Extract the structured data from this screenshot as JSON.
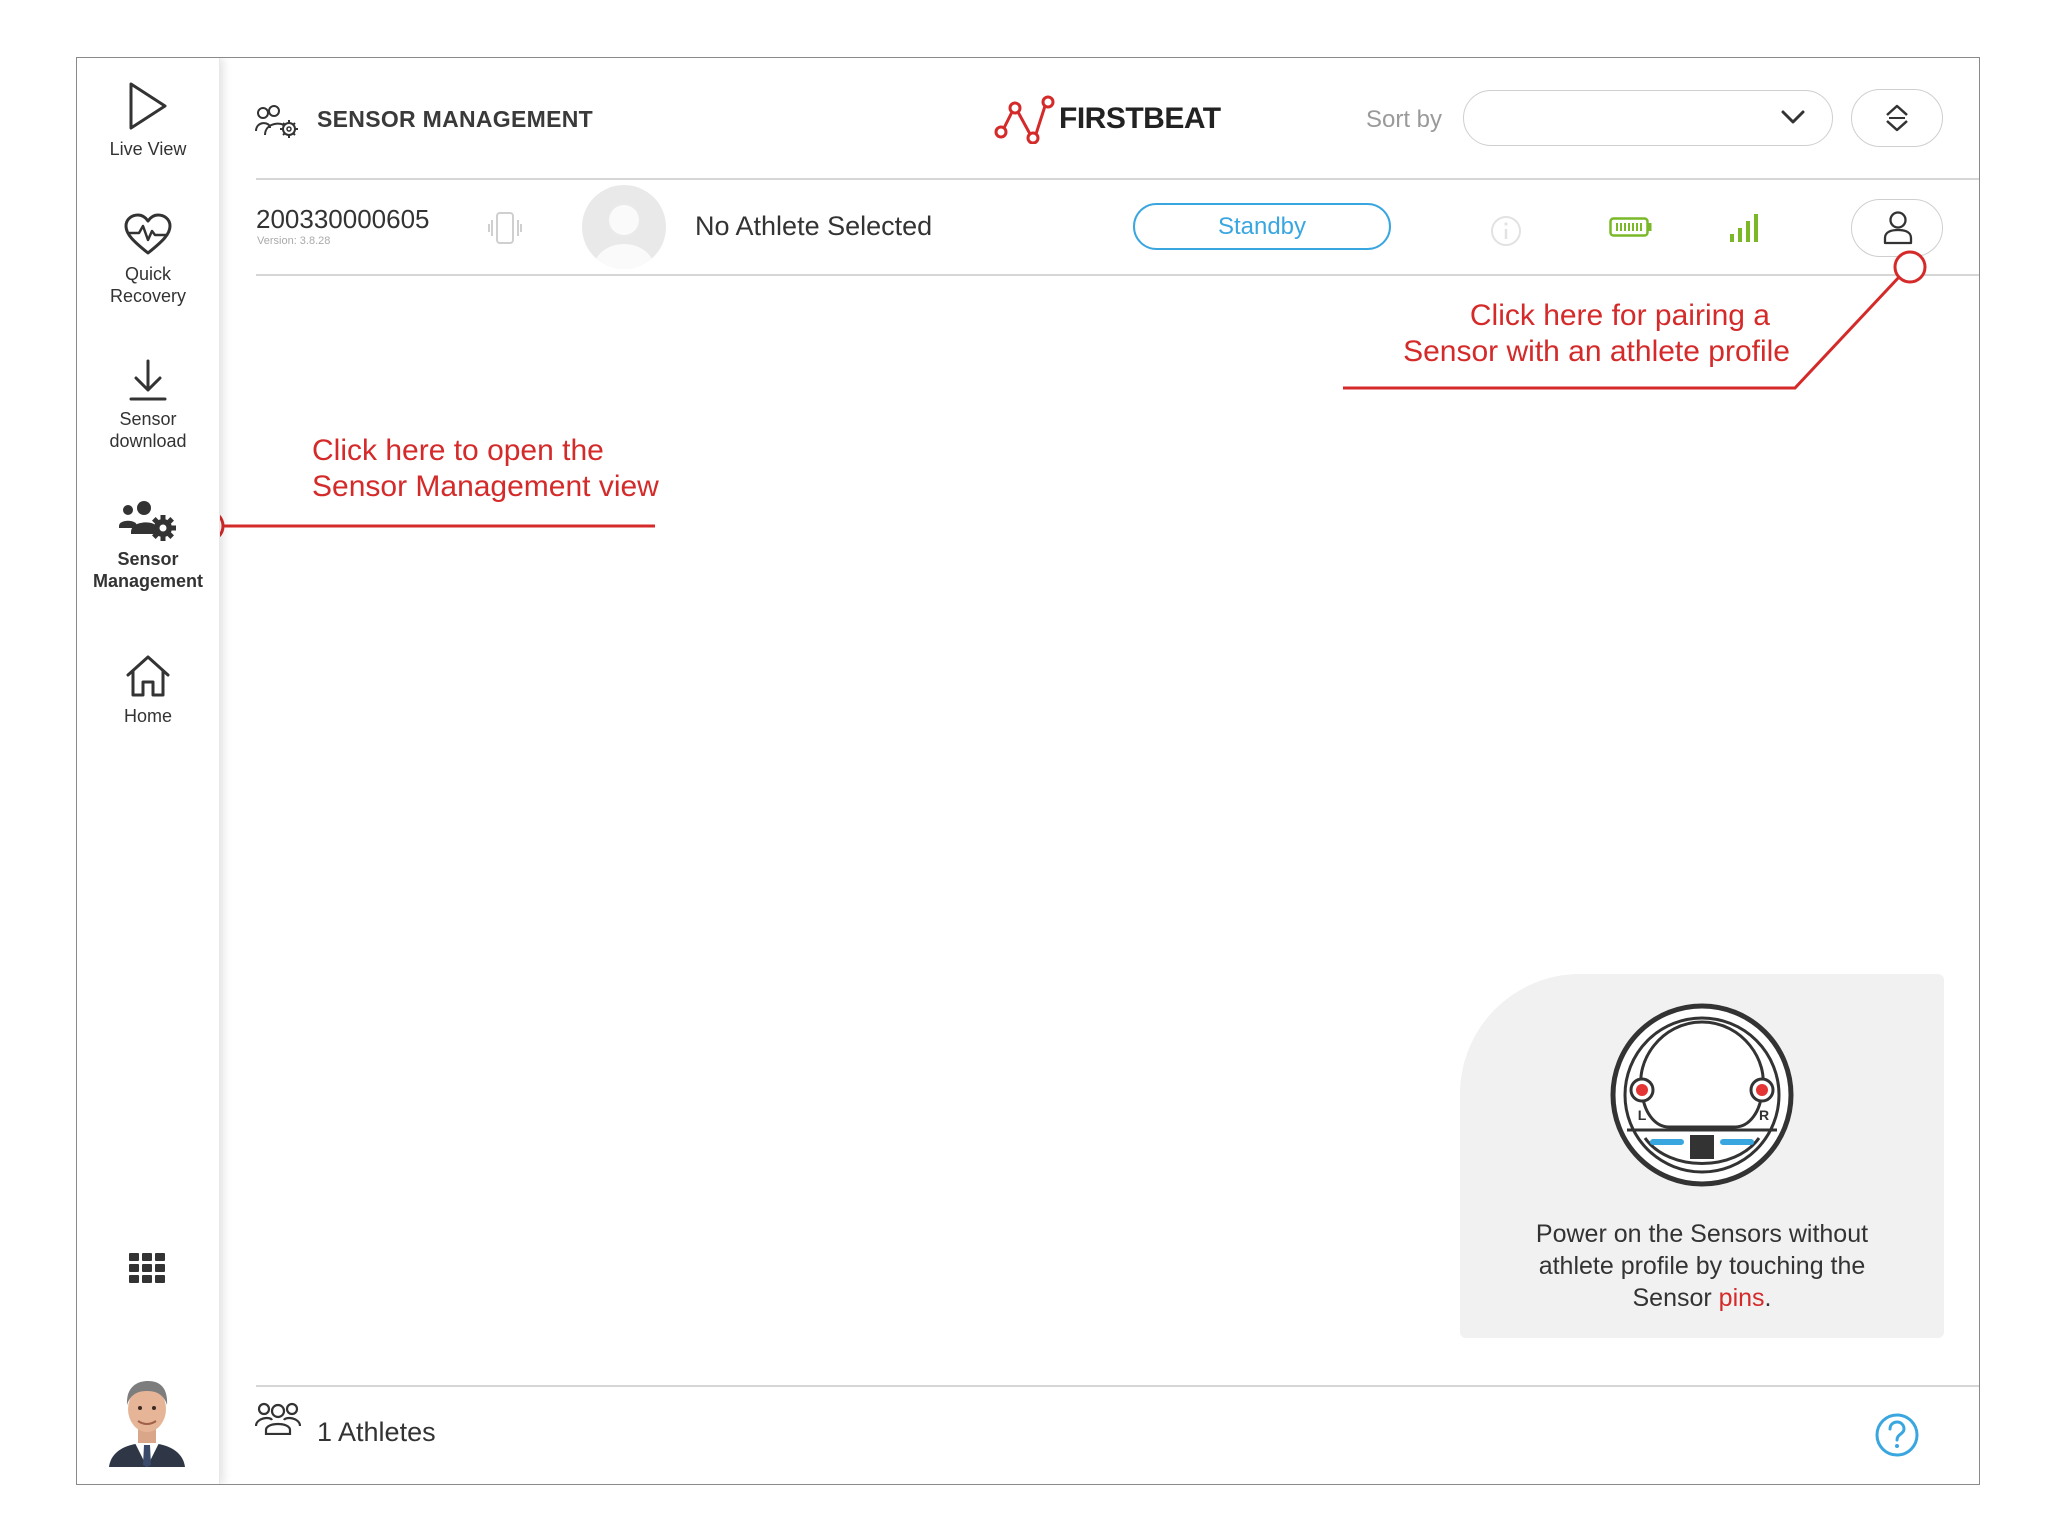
{
  "sidebar": {
    "items": [
      {
        "label": "Live View",
        "icon": "play-icon"
      },
      {
        "label": "Quick\nRecovery",
        "icon": "heart-pulse-icon"
      },
      {
        "label": "Sensor\ndownload",
        "icon": "download-icon"
      },
      {
        "label": "Sensor\nManagement",
        "icon": "sensor-management-icon",
        "active": true
      },
      {
        "label": "Home",
        "icon": "home-icon"
      }
    ],
    "apps_icon": "grid-icon",
    "avatar": "user-avatar"
  },
  "header": {
    "title": "SENSOR MANAGEMENT",
    "brand": "FIRSTBEAT",
    "sort_label": "Sort by",
    "sort_value": ""
  },
  "sensor_row": {
    "serial": "200330000605",
    "version": "Version: 3.8.28",
    "athlete": "No Athlete Selected",
    "status": "Standby"
  },
  "callouts": {
    "pairing_line1": "Click here for pairing a",
    "pairing_line2": "Sensor with an athlete profile",
    "sidebar_line1": "Click here to open the",
    "sidebar_line2": "Sensor Management view"
  },
  "tip": {
    "text_before": "Power on the Sensors without athlete profile by touching the Sensor ",
    "highlight": "pins",
    "text_after": ".",
    "left_pin": "L",
    "right_pin": "R"
  },
  "footer": {
    "athletes_count": "1 Athletes"
  },
  "colors": {
    "accent_red": "#d42a2a",
    "status_blue": "#3aa6e0",
    "battery_green": "#7ab828"
  }
}
